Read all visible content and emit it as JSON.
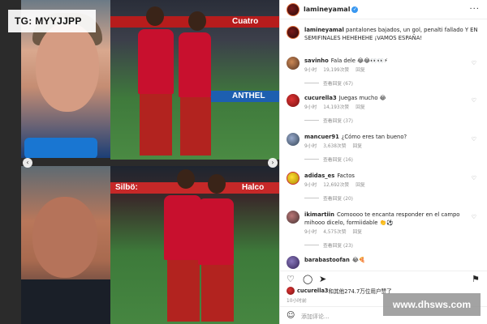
{
  "watermark_top": "TG: MYYJJPP",
  "watermark_bottom": "www.dhsws.com",
  "photos": {
    "ad_top_1": "Cuatro",
    "ad_top_2": "ANTHEL",
    "ad_bottom_1": "Silbö:",
    "ad_bottom_2": "Halco"
  },
  "post": {
    "username": "lamineyamal",
    "caption_user": "lamineyamal",
    "caption_text": "pantalones bajados, un gol, penalti fallado Y EN SEMIFINALES HEHEHEHE ¡VAMOS ESPAÑA!"
  },
  "comments": [
    {
      "user": "savinho",
      "text": "Fala dele 😂😂👀👀⚡",
      "age": "9小时",
      "likes": "19,199次赞",
      "reply": "回复",
      "replies": "查看回复 (67)"
    },
    {
      "user": "cucurella3",
      "text": "Juegas mucho 😂",
      "age": "9小时",
      "likes": "14,193次赞",
      "reply": "回复",
      "replies": "查看回复 (37)"
    },
    {
      "user": "mancuer91",
      "text": "¿Cómo eres tan bueno?",
      "age": "9小时",
      "likes": "3,638次赞",
      "reply": "回复",
      "replies": "查看回复 (16)"
    },
    {
      "user": "adidas_es",
      "text": "Factos",
      "age": "9小时",
      "likes": "12,692次赞",
      "reply": "回复",
      "replies": "查看回复 (20)"
    },
    {
      "user": "ikimartiin",
      "text": "Comoooo te encanta responder en el campo mihooo dicelo, formiidable 👏⚽",
      "age": "9小时",
      "likes": "4,575次赞",
      "reply": "回复",
      "replies": "查看回复 (23)"
    },
    {
      "user": "barabastoofan",
      "text": "😂🍕",
      "age": "",
      "likes": "",
      "reply": "",
      "replies": ""
    }
  ],
  "likes_line": {
    "user": "cucurella3",
    "text": "和其他274.7万位用户赞了"
  },
  "post_time": "10小时前",
  "add_comment_placeholder": "添加评论..."
}
